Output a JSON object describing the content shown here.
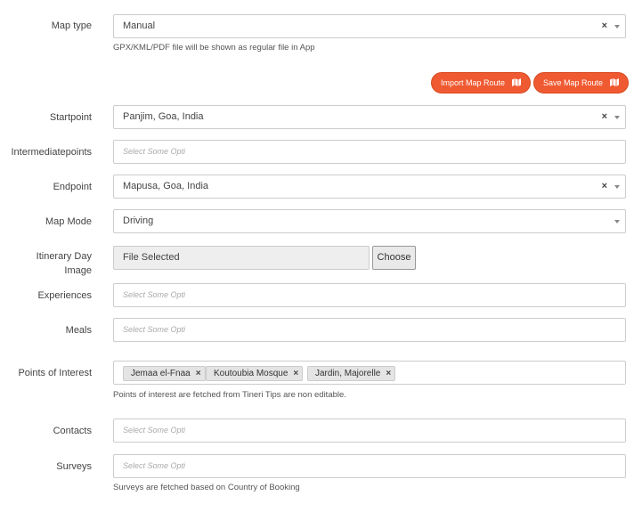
{
  "map_type": {
    "label": "Map type",
    "value": "Manual",
    "clear": "×",
    "help": "GPX/KML/PDF file will be shown as regular file in App"
  },
  "route_buttons": {
    "import_label": "Import Map Route",
    "save_label": "Save Map Route"
  },
  "startpoint": {
    "label": "Startpoint",
    "value": "Panjim, Goa, India",
    "clear": "×"
  },
  "intermediate": {
    "label": "Intermediatepoints",
    "placeholder": "Select Some Opti"
  },
  "endpoint": {
    "label": "Endpoint",
    "value": "Mapusa, Goa, India",
    "clear": "×"
  },
  "map_mode": {
    "label": "Map Mode",
    "value": "Driving"
  },
  "itinerary_image": {
    "label_line1": "Itinerary Day",
    "label_line2": "Image",
    "file_text": "File Selected",
    "choose_label": "Choose"
  },
  "experiences": {
    "label": "Experiences",
    "placeholder": "Select Some Opti"
  },
  "meals": {
    "label": "Meals",
    "placeholder": "Select Some Opti"
  },
  "points_of_interest": {
    "label": "Points of Interest",
    "tags": [
      "Jemaa el-Fnaa",
      "Koutoubia Mosque",
      "Jardin, Majorelle"
    ],
    "remove": "×",
    "help": "Points of interest are fetched from Tineri Tips are non editable."
  },
  "contacts": {
    "label": "Contacts",
    "placeholder": "Select Some Opti"
  },
  "surveys": {
    "label": "Surveys",
    "placeholder": "Select Some Opti",
    "help": "Surveys are fetched based on Country of Booking"
  }
}
